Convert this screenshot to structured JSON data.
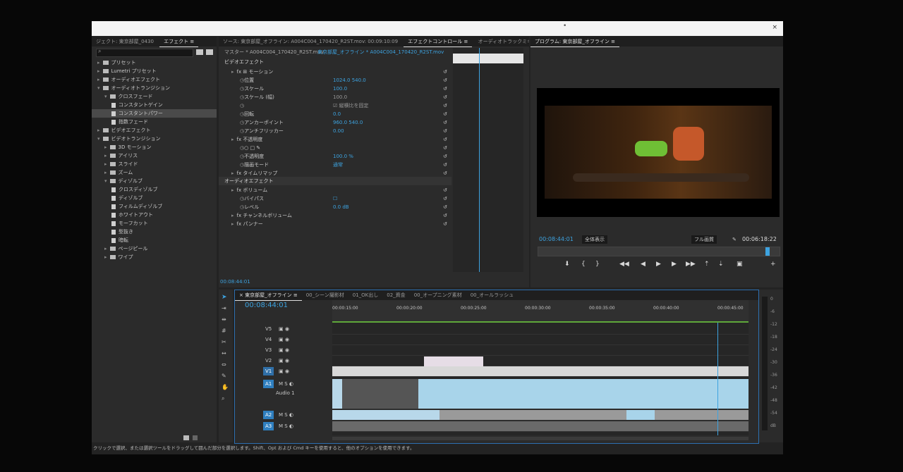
{
  "window": {
    "close": "×",
    "dot": "•"
  },
  "effects_panel": {
    "tabs": [
      "ジェクト: 東京部屋_0430",
      "エフェクト ≡"
    ],
    "search_placeholder": "",
    "tree": [
      {
        "label": "プリセット",
        "level": 0,
        "type": "folder",
        "open": false
      },
      {
        "label": "Lumetri プリセット",
        "level": 0,
        "type": "folder",
        "open": false
      },
      {
        "label": "オーディオエフェクト",
        "level": 0,
        "type": "folder",
        "open": false
      },
      {
        "label": "オーディオトランジション",
        "level": 0,
        "type": "folder",
        "open": true
      },
      {
        "label": "クロスフェード",
        "level": 1,
        "type": "folder",
        "open": true
      },
      {
        "label": "コンスタントゲイン",
        "level": 2,
        "type": "item"
      },
      {
        "label": "コンスタントパワー",
        "level": 2,
        "type": "item",
        "selected": true
      },
      {
        "label": "指数フェード",
        "level": 2,
        "type": "item"
      },
      {
        "label": "ビデオエフェクト",
        "level": 0,
        "type": "folder",
        "open": false
      },
      {
        "label": "ビデオトランジション",
        "level": 0,
        "type": "folder",
        "open": true
      },
      {
        "label": "3D モーション",
        "level": 1,
        "type": "folder",
        "open": false
      },
      {
        "label": "アイリス",
        "level": 1,
        "type": "folder",
        "open": false
      },
      {
        "label": "スライド",
        "level": 1,
        "type": "folder",
        "open": false
      },
      {
        "label": "ズーム",
        "level": 1,
        "type": "folder",
        "open": false
      },
      {
        "label": "ディゾルブ",
        "level": 1,
        "type": "folder",
        "open": true
      },
      {
        "label": "クロスディゾルブ",
        "level": 2,
        "type": "item"
      },
      {
        "label": "ディゾルブ",
        "level": 2,
        "type": "item"
      },
      {
        "label": "フィルムディゾルブ",
        "level": 2,
        "type": "item"
      },
      {
        "label": "ホワイトアウト",
        "level": 2,
        "type": "item"
      },
      {
        "label": "モーフカット",
        "level": 2,
        "type": "item"
      },
      {
        "label": "型抜き",
        "level": 2,
        "type": "item"
      },
      {
        "label": "暗転",
        "level": 2,
        "type": "item"
      },
      {
        "label": "ページピール",
        "level": 1,
        "type": "folder",
        "open": false
      },
      {
        "label": "ワイプ",
        "level": 1,
        "type": "folder",
        "open": false
      }
    ]
  },
  "effect_controls": {
    "tabs": [
      "ソース: 東京部屋_オフライン: A004C004_170420_R2ST.mov: 00:09:10:09",
      "エフェクトコントロール ≡",
      "オーディオトラックミキ"
    ],
    "master": "マスター * A004C004_170420_R2ST.mov",
    "sequence": "東京部屋_オフライン * A004C004_170420_R2ST.mov",
    "video_effects_label": "ビデオエフェクト",
    "audio_effects_label": "オーディオエフェクト",
    "rows": [
      {
        "indent": 1,
        "label": "fx ⊞ モーション",
        "value": ""
      },
      {
        "indent": 2,
        "label": "位置",
        "value": "1024.0    540.0"
      },
      {
        "indent": 2,
        "label": "スケール",
        "value": "100.0"
      },
      {
        "indent": 2,
        "label": "スケール (幅)",
        "value": "100.0",
        "dim": true
      },
      {
        "indent": 2,
        "label": "",
        "value": "☑ 縦横比を固定",
        "dim": true
      },
      {
        "indent": 2,
        "label": "回転",
        "value": "0.0"
      },
      {
        "indent": 2,
        "label": "アンカーポイント",
        "value": "960.0    540.0"
      },
      {
        "indent": 2,
        "label": "アンチフリッカー",
        "value": "0.00"
      },
      {
        "indent": 1,
        "label": "fx 不透明度",
        "value": ""
      },
      {
        "indent": 2,
        "label": "○ □ ✎",
        "value": ""
      },
      {
        "indent": 2,
        "label": "不透明度",
        "value": "100.0 %"
      },
      {
        "indent": 2,
        "label": "描画モード",
        "value": "通常"
      },
      {
        "indent": 1,
        "label": "fx タイムリマップ",
        "value": ""
      }
    ],
    "audio_rows": [
      {
        "indent": 1,
        "label": "fx ボリューム",
        "value": ""
      },
      {
        "indent": 2,
        "label": "バイパス",
        "value": "☐"
      },
      {
        "indent": 2,
        "label": "レベル",
        "value": "0.0 dB"
      },
      {
        "indent": 1,
        "label": "fx チャンネルボリューム",
        "value": ""
      },
      {
        "indent": 1,
        "label": "fx パンナー",
        "value": ""
      }
    ],
    "timecode": "00:08:44:01"
  },
  "program_monitor": {
    "title": "プログラム: 東京部屋_オフライン ≡",
    "timecode": "00:08:44:01",
    "fit": "全体表示",
    "quality": "フル画質",
    "duration": "00:06:18:22"
  },
  "timeline": {
    "tabs": [
      "× 東京部屋_オフライン ≡",
      "00_シーン撮影材",
      "01_OK出し",
      "02_資金",
      "00_オープニング素材",
      "00_オールラッシュ"
    ],
    "timecode": "00:08:44:01",
    "ruler": [
      "00:00:15:00",
      "00:00:20:00",
      "00:00:25:00",
      "00:00:30:00",
      "00:00:35:00",
      "00:00:40:00",
      "00:00:45:00"
    ],
    "tracks": [
      "V5",
      "V4",
      "V3",
      "V2",
      "V1",
      "A1",
      "A2",
      "A3"
    ],
    "audio1_name": "Audio 1",
    "meter_scale": [
      "0",
      "-6",
      "-12",
      "-18",
      "-24",
      "-30",
      "-36",
      "-42",
      "-48",
      "-54",
      "dB"
    ]
  },
  "status_bar": "クリックで選択、または選択ツールをドラッグして囲んだ部分を選択します。Shift、Opt および Cmd キーを使用すると、他のオプションを使用できます。",
  "colors": {
    "accent": "#3da3e0",
    "panel": "#2b2b2b",
    "bg": "#232323"
  }
}
